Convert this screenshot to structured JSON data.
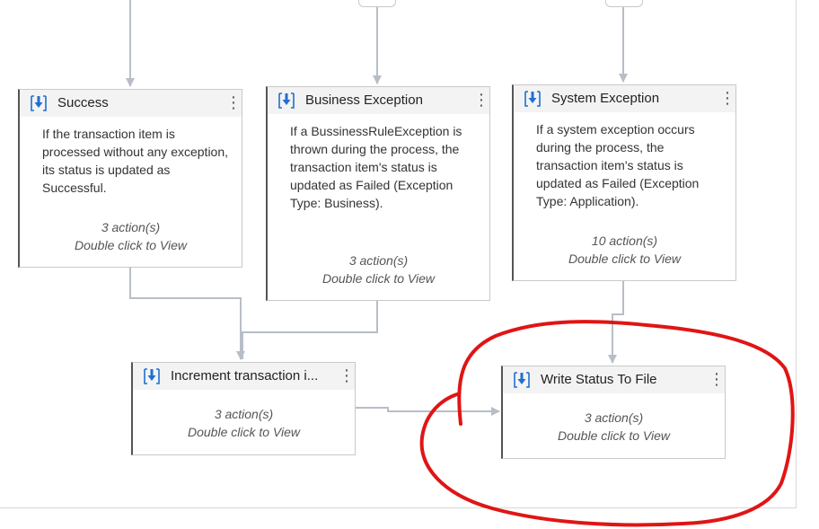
{
  "states": [
    {
      "id": "success",
      "title": "Success",
      "description": "If the transaction item is processed without any exception, its status is updated as Successful.",
      "actions": "3 action(s)",
      "hint": "Double click to View"
    },
    {
      "id": "business-exception",
      "title": "Business Exception",
      "description": "If a BussinessRuleException is thrown during the process, the transaction item's status is updated as Failed (Exception Type: Business).",
      "actions": "3 action(s)",
      "hint": "Double click to View"
    },
    {
      "id": "system-exception",
      "title": "System Exception",
      "description": "If a system exception occurs during the process, the transaction item's status is updated as Failed (Exception Type: Application).",
      "actions": "10 action(s)",
      "hint": "Double click to View"
    },
    {
      "id": "increment-transaction",
      "title": "Increment transaction i...",
      "actions": "3 action(s)",
      "hint": "Double click to View"
    },
    {
      "id": "write-status",
      "title": "Write Status To File",
      "actions": "3 action(s)",
      "hint": "Double click to View"
    }
  ],
  "colors": {
    "connector": "#b8bec7",
    "annotation": "#e01515",
    "icon_blue": "#1f6fd1"
  },
  "icons": {
    "state": "sequence-download-icon",
    "menu": "more-vertical-icon",
    "grip": "resize-grip-icon"
  }
}
